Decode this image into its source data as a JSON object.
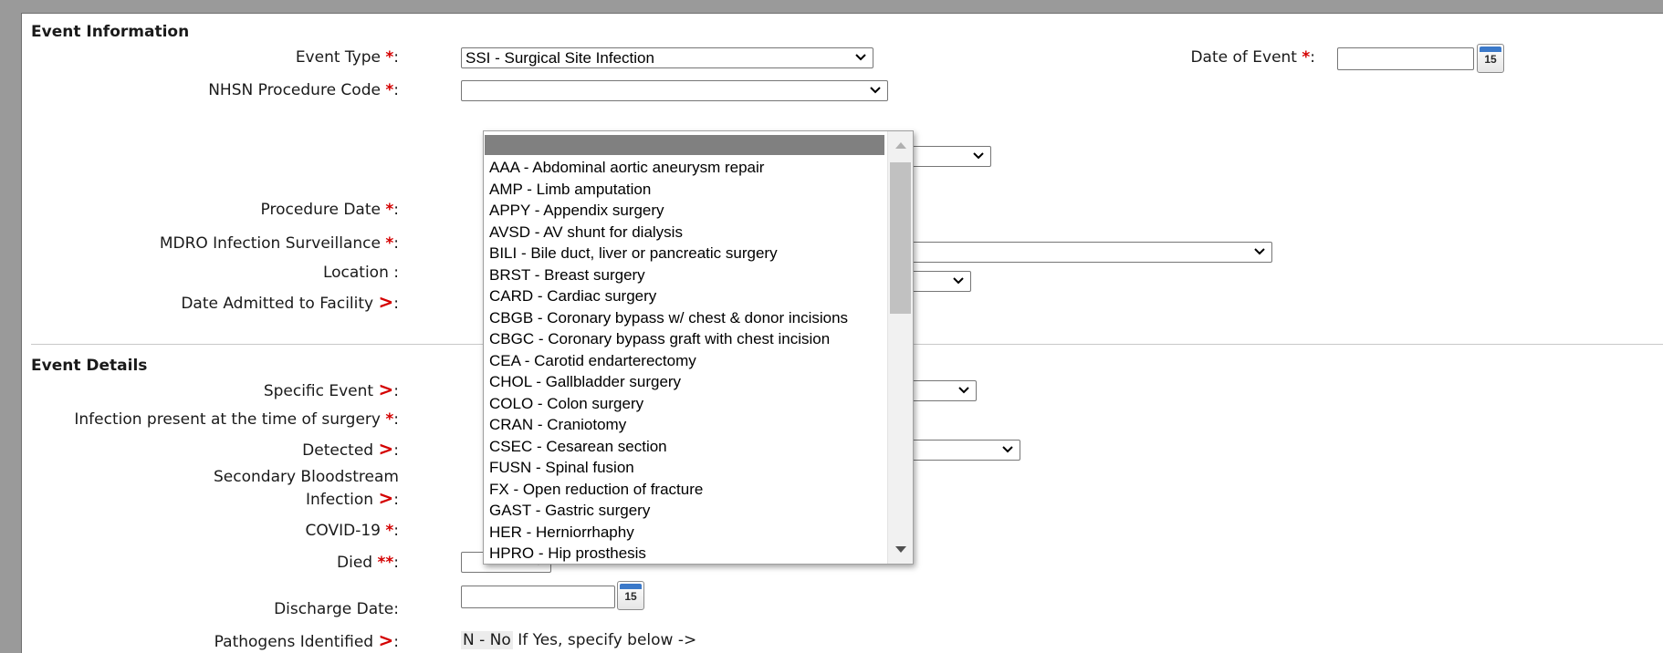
{
  "event_information": {
    "title": "Event Information",
    "event_type": {
      "label": "Event Type",
      "value": "SSI - Surgical Site Infection"
    },
    "date_of_event": {
      "label": "Date of Event",
      "value": ""
    },
    "nhsn_procedure_code": {
      "label": "NHSN Procedure Code",
      "value": ""
    },
    "procedure_date": {
      "label": "Procedure Date"
    },
    "mdro_surveillance": {
      "label": "MDRO Infection Surveillance"
    },
    "location": {
      "label": "Location"
    },
    "date_admitted": {
      "label": "Date Admitted to Facility"
    }
  },
  "event_details": {
    "title": "Event Details",
    "specific_event": {
      "label": "Specific Event"
    },
    "infection_present": {
      "label": "Infection present at the time of surgery"
    },
    "detected": {
      "label": "Detected"
    },
    "secondary_bsi": {
      "label_line1": "Secondary Bloodstream",
      "label_line2": "Infection"
    },
    "covid19": {
      "label": "COVID-19"
    },
    "died": {
      "label": "Died",
      "value": ""
    },
    "discharge_date": {
      "label": "Discharge Date",
      "value": ""
    },
    "pathogens": {
      "label": "Pathogens Identified",
      "value": "N - No",
      "hint": "If Yes, specify below ->"
    }
  },
  "required_star": "*",
  "required_double_star": "**",
  "conditional_marker": ">",
  "colon": ":",
  "calendar_icon_text": "15",
  "procedure_code_options": [
    "AAA - Abdominal aortic aneurysm repair",
    "AMP - Limb amputation",
    "APPY - Appendix surgery",
    "AVSD - AV shunt for dialysis",
    "BILI - Bile duct, liver or pancreatic surgery",
    "BRST - Breast surgery",
    "CARD - Cardiac surgery",
    "CBGB - Coronary bypass w/ chest & donor incisions",
    "CBGC - Coronary bypass graft with chest incision",
    "CEA - Carotid endarterectomy",
    "CHOL - Gallbladder surgery",
    "COLO - Colon surgery",
    "CRAN - Craniotomy",
    "CSEC - Cesarean section",
    "FUSN - Spinal fusion",
    "FX - Open reduction of fracture",
    "GAST - Gastric surgery",
    "HER - Herniorrhaphy",
    "HPRO - Hip prosthesis"
  ],
  "colors": {
    "required": "#d40000",
    "highlight": "#808080",
    "calendar_accent": "#3b79c9"
  }
}
